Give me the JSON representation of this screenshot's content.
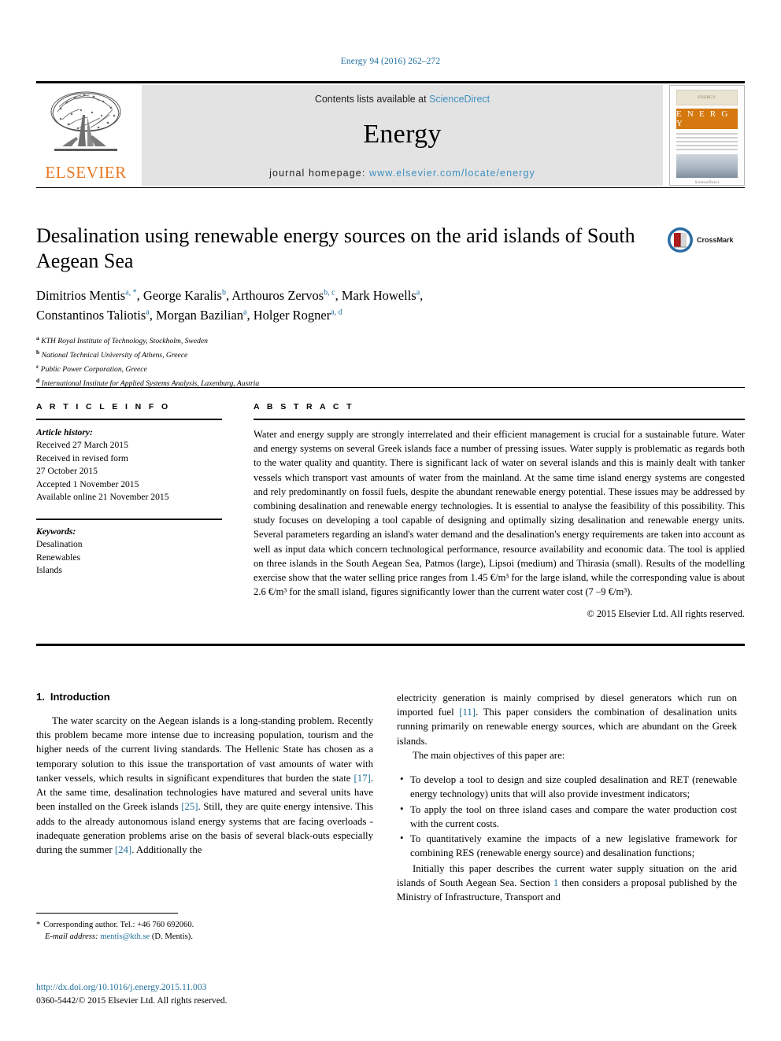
{
  "running_head": "Energy 94 (2016) 262–272",
  "masthead": {
    "publisher_name": "ELSEVIER",
    "contents_prefix": "Contents lists available at ",
    "contents_link": "ScienceDirect",
    "journal_name": "Energy",
    "homepage_prefix": "journal homepage: ",
    "homepage_url": "www.elsevier.com/locate/energy",
    "cover": {
      "top_strip": "ENERGY",
      "band_title": "E N E R G Y",
      "footer": "ScienceDirect"
    }
  },
  "article": {
    "title": "Desalination using renewable energy sources on the arid islands of South Aegean Sea",
    "authors_line_1_parts": [
      {
        "name": "Dimitrios Mentis",
        "sup": "a, *"
      },
      {
        "name": "George Karalis",
        "sup": "b"
      },
      {
        "name": "Arthouros Zervos",
        "sup": "b, c"
      },
      {
        "name": "Mark Howells",
        "sup": "a"
      }
    ],
    "authors_line_2_parts": [
      {
        "name": "Constantinos Taliotis",
        "sup": "a"
      },
      {
        "name": "Morgan Bazilian",
        "sup": "a"
      },
      {
        "name": "Holger Rogner",
        "sup": "a, d"
      }
    ],
    "affiliations": [
      {
        "mark": "a",
        "text": "KTH Royal Institute of Technology, Stockholm, Sweden"
      },
      {
        "mark": "b",
        "text": "National Technical University of Athens, Greece"
      },
      {
        "mark": "c",
        "text": "Public Power Corporation, Greece"
      },
      {
        "mark": "d",
        "text": "International Institute for Applied Systems Analysis, Laxenburg, Austria"
      }
    ],
    "crossmark_label": "CrossMark"
  },
  "info": {
    "heading": "A R T I C L E   I N F O",
    "history_label": "Article history:",
    "history": [
      "Received 27 March 2015",
      "Received in revised form",
      "27 October 2015",
      "Accepted 1 November 2015",
      "Available online 21 November 2015"
    ],
    "keywords_label": "Keywords:",
    "keywords": [
      "Desalination",
      "Renewables",
      "Islands"
    ]
  },
  "abstract": {
    "heading": "A B S T R A C T",
    "text": "Water and energy supply are strongly interrelated and their efficient management is crucial for a sustainable future. Water and energy systems on several Greek islands face a number of pressing issues. Water supply is problematic as regards both to the water quality and quantity. There is significant lack of water on several islands and this is mainly dealt with tanker vessels which transport vast amounts of water from the mainland. At the same time island energy systems are congested and rely predominantly on fossil fuels, despite the abundant renewable energy potential. These issues may be addressed by combining desalination and renewable energy technologies. It is essential to analyse the feasibility of this possibility. This study focuses on developing a tool capable of designing and optimally sizing desalination and renewable energy units. Several parameters regarding an island's water demand and the desalination's energy requirements are taken into account as well as input data which concern technological performance, resource availability and economic data. The tool is applied on three islands in the South Aegean Sea, Patmos (large), Lipsoi (medium) and Thirasia (small). Results of the modelling exercise show that the water selling price ranges from 1.45 €/m³ for the large island, while the corresponding value is about 2.6 €/m³ for the small island, figures significantly lower than the current water cost (7 –9 €/m³).",
    "copyright": "© 2015 Elsevier Ltd. All rights reserved."
  },
  "body": {
    "section_number": "1.",
    "section_title": "Introduction",
    "left_paragraph_1": "The water scarcity on the Aegean islands is a long-standing problem. Recently this problem became more intense due to increasing population, tourism and the higher needs of the current living standards. The Hellenic State has chosen as a temporary solution to this issue the transportation of vast amounts of water with tanker vessels, which results in significant expenditures that burden the state ",
    "ref_17": "[17]",
    "left_paragraph_2": ". At the same time, desalination technologies have matured and several units have been installed on the Greek islands ",
    "ref_25": "[25]",
    "left_paragraph_3": ". Still, they are quite energy intensive. This adds to the already autonomous island energy systems that are facing overloads -inadequate generation problems arise on the basis of several black-outs especially during the summer ",
    "ref_24": "[24]",
    "left_paragraph_4": ". Additionally the",
    "right_paragraph_1": "electricity generation is mainly comprised by diesel generators which run on imported fuel ",
    "ref_11": "[11]",
    "right_paragraph_2": ". This paper considers the combination of desalination units running primarily on renewable energy sources, which are abundant on the Greek islands.",
    "objectives_intro": "The main objectives of this paper are:",
    "objectives": [
      "To develop a tool to design and size coupled desalination and RET (renewable energy technology) units that will also provide investment indicators;",
      "To apply the tool on three island cases and compare the water production cost with the current costs.",
      "To quantitatively examine the impacts of a new legislative framework for combining RES (renewable energy source) and desalination functions;"
    ],
    "closing_paragraph_1": "Initially this paper describes the current water supply situation on the arid islands of South Aegean Sea. Section ",
    "section_ref": "1",
    "closing_paragraph_2": " then considers a proposal published by the Ministry of Infrastructure, Transport and"
  },
  "footnotes": {
    "corresponding": "Corresponding author. Tel.: +46 760 692060.",
    "email_label": "E-mail address:",
    "email": "mentis@kth.se",
    "email_suffix": "(D. Mentis).",
    "doi": "http://dx.doi.org/10.1016/j.energy.2015.11.003",
    "issn_line": "0360-5442/© 2015 Elsevier Ltd. All rights reserved."
  }
}
